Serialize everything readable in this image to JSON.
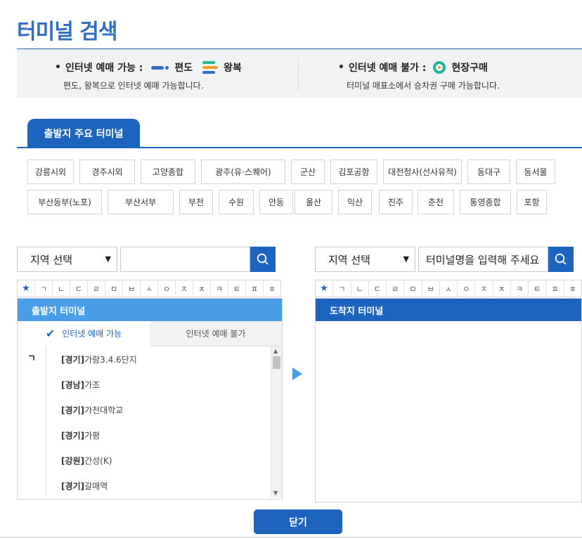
{
  "page_title": "터미널 검색",
  "info": {
    "left": {
      "label": "인터넷 예매 가능 :",
      "oneway_label": "편도",
      "round_label": "왕복",
      "desc": "편도, 왕복으로 인터넷 예매 가능합니다."
    },
    "right": {
      "label": "인터넷 예매 불가 :",
      "onsite_label": "현장구매",
      "desc": "터미널 매표소에서 승차권 구매 가능합니다."
    },
    "colors": {
      "oneway": "#2f6ec3",
      "round_top": "#1fb69c",
      "round_mid": "#f59b21",
      "round_bot": "#2f6ec3",
      "onsite_ring": "#1fb69c",
      "onsite_core": "#f59b21"
    }
  },
  "major_tab": "출발지 주요 터미널",
  "major_terminals": [
    "강릉시외",
    "경주시외",
    "고양종합",
    "광주(유·스퀘어)",
    "군산",
    "김포공항",
    "대전청사(선사유적)",
    "동대구",
    "동서울",
    "부산동부(노포)",
    "부산서부",
    "부천",
    "수원",
    "안동",
    "울산",
    "익산",
    "진주",
    "춘천",
    "통영종합",
    "포항"
  ],
  "left_search": {
    "region_select": "지역 선택",
    "input_value": "",
    "input_placeholder": ""
  },
  "right_search": {
    "region_select": "지역 선택",
    "input_placeholder": "터미널명을 입력해 주세요"
  },
  "alphabet": [
    "★",
    "ㄱ",
    "ㄴ",
    "ㄷ",
    "ㄹ",
    "ㅁ",
    "ㅂ",
    "ㅅ",
    "ㅇ",
    "ㅈ",
    "ㅊ",
    "ㅋ",
    "ㅌ",
    "ㅍ",
    "ㅎ"
  ],
  "departure": {
    "header": "출발지 터미널",
    "tab_available": "인터넷 예매 가능",
    "tab_unavailable": "인터넷 예매 불가",
    "current_initial": "ㄱ",
    "items": [
      {
        "region": "[경기]",
        "name": "가람3.4.6단지"
      },
      {
        "region": "[경남]",
        "name": "가조"
      },
      {
        "region": "[경기]",
        "name": "가천대학교"
      },
      {
        "region": "[경기]",
        "name": "가평"
      },
      {
        "region": "[강원]",
        "name": "간성(K)"
      },
      {
        "region": "[경기]",
        "name": "갈매역"
      }
    ]
  },
  "arrival": {
    "header": "도착지 터미널"
  },
  "close_button": "닫기",
  "colors": {
    "accent": "#1d64be",
    "header_light": "#4a9ee8",
    "title": "#2f6ec3"
  }
}
